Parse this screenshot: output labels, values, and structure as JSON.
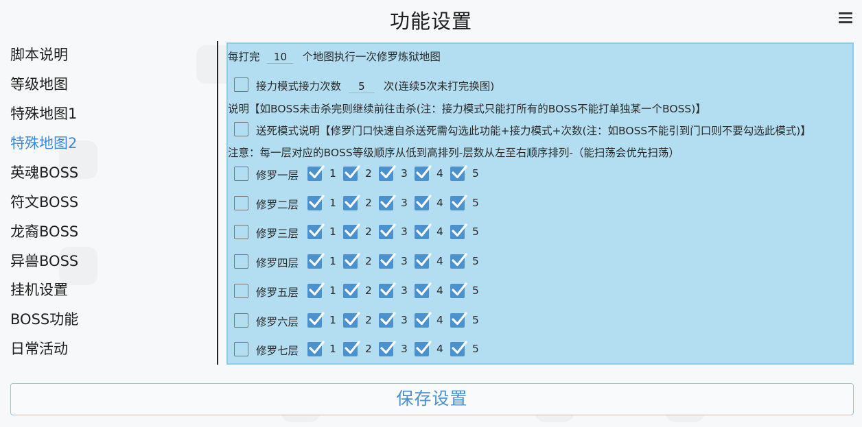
{
  "header": {
    "title": "功能设置",
    "menu_icon": "hamburger-menu-icon"
  },
  "sidebar": {
    "items": [
      {
        "label": "脚本说明",
        "active": false
      },
      {
        "label": "等级地图",
        "active": false
      },
      {
        "label": "特殊地图1",
        "active": false
      },
      {
        "label": "特殊地图2",
        "active": true
      },
      {
        "label": "英魂BOSS",
        "active": false
      },
      {
        "label": "符文BOSS",
        "active": false
      },
      {
        "label": "龙裔BOSS",
        "active": false
      },
      {
        "label": "异兽BOSS",
        "active": false
      },
      {
        "label": "挂机设置",
        "active": false
      },
      {
        "label": "BOSS功能",
        "active": false
      },
      {
        "label": "日常活动",
        "active": false
      }
    ]
  },
  "panel": {
    "line1": {
      "prefix": "每打完",
      "value": "10",
      "suffix": "个地图执行一次修罗炼狱地图"
    },
    "relay": {
      "checked": false,
      "label": "接力模式接力次数",
      "value": "5",
      "suffix": "次(连续5次未打完换图)"
    },
    "explain": "说明【如BOSS未击杀完则继续前往击杀(注：接力模式只能打所有的BOSS不能打单独某一个BOSS)】",
    "suicide": {
      "checked": false,
      "label": "送死模式说明【修罗门口快速自杀送死需勾选此功能+接力模式+次数(注：如BOSS不能引到门口则不要勾选此模式)】"
    },
    "note": "注意：每一层对应的BOSS等级顺序从低到高排列-层数从左至右顺序排列-（能扫荡会优先扫荡）",
    "floors": [
      {
        "label": "修罗一层",
        "checked": false,
        "levels": [
          "1",
          "2",
          "3",
          "4",
          "5"
        ],
        "level_checked": [
          true,
          true,
          true,
          true,
          true
        ]
      },
      {
        "label": "修罗二层",
        "checked": false,
        "levels": [
          "1",
          "2",
          "3",
          "4",
          "5"
        ],
        "level_checked": [
          true,
          true,
          true,
          true,
          true
        ]
      },
      {
        "label": "修罗三层",
        "checked": false,
        "levels": [
          "1",
          "2",
          "3",
          "4",
          "5"
        ],
        "level_checked": [
          true,
          true,
          true,
          true,
          true
        ]
      },
      {
        "label": "修罗四层",
        "checked": false,
        "levels": [
          "1",
          "2",
          "3",
          "4",
          "5"
        ],
        "level_checked": [
          true,
          true,
          true,
          true,
          true
        ]
      },
      {
        "label": "修罗五层",
        "checked": false,
        "levels": [
          "1",
          "2",
          "3",
          "4",
          "5"
        ],
        "level_checked": [
          true,
          true,
          true,
          true,
          true
        ]
      },
      {
        "label": "修罗六层",
        "checked": false,
        "levels": [
          "1",
          "2",
          "3",
          "4",
          "5"
        ],
        "level_checked": [
          true,
          true,
          true,
          true,
          true
        ]
      },
      {
        "label": "修罗七层",
        "checked": false,
        "levels": [
          "1",
          "2",
          "3",
          "4",
          "5"
        ],
        "level_checked": [
          true,
          true,
          true,
          true,
          true
        ]
      }
    ]
  },
  "footer": {
    "save_label": "保存设置"
  },
  "colors": {
    "accent": "#3b8ad9",
    "panel_bg": "#b3def2",
    "checkbox_checked": "#4a91ce"
  }
}
